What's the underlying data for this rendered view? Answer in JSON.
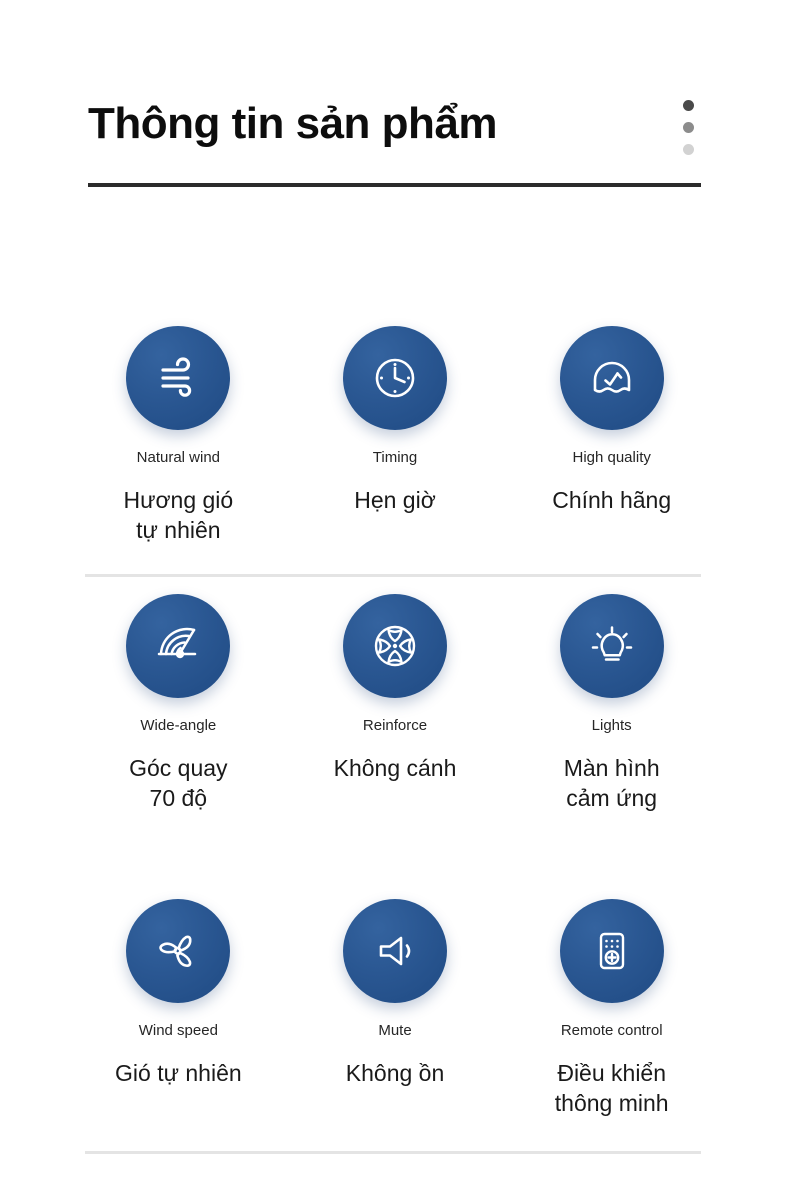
{
  "header": {
    "title": "Thông tin sản phẩm",
    "menu_dots": [
      "dot-dark",
      "dot-medium",
      "dot-light"
    ]
  },
  "colors": {
    "icon_circle_blue": "#2a5792",
    "title_rule": "#2b2b2b",
    "divider": "#e4e4e4",
    "dot_dark": "#4a4a4a",
    "dot_medium": "#8c8c8c",
    "dot_light": "#d2d2d2"
  },
  "features": [
    [
      {
        "icon": "wind-lines-icon",
        "label_en": "Natural wind",
        "label_vi": "Hương gió\ntự nhiên"
      },
      {
        "icon": "clock-icon",
        "label_en": "Timing",
        "label_vi": "Hẹn giờ"
      },
      {
        "icon": "quality-badge-icon",
        "label_en": "High quality",
        "label_vi": "Chính hãng"
      }
    ],
    [
      {
        "icon": "gauge-wide-angle-icon",
        "label_en": "Wide-angle",
        "label_vi": "Góc quay\n70 độ"
      },
      {
        "icon": "bladeless-wheel-icon",
        "label_en": "Reinforce",
        "label_vi": "Không cánh"
      },
      {
        "icon": "light-bulb-icon",
        "label_en": "Lights",
        "label_vi": "Màn hình\ncảm ứng"
      }
    ],
    [
      {
        "icon": "fan-propeller-icon",
        "label_en": "Wind speed",
        "label_vi": "Gió tự nhiên"
      },
      {
        "icon": "speaker-mute-icon",
        "label_en": "Mute",
        "label_vi": "Không ồn"
      },
      {
        "icon": "remote-control-icon",
        "label_en": "Remote control",
        "label_vi": "Điều khiển\nthông minh"
      }
    ]
  ]
}
